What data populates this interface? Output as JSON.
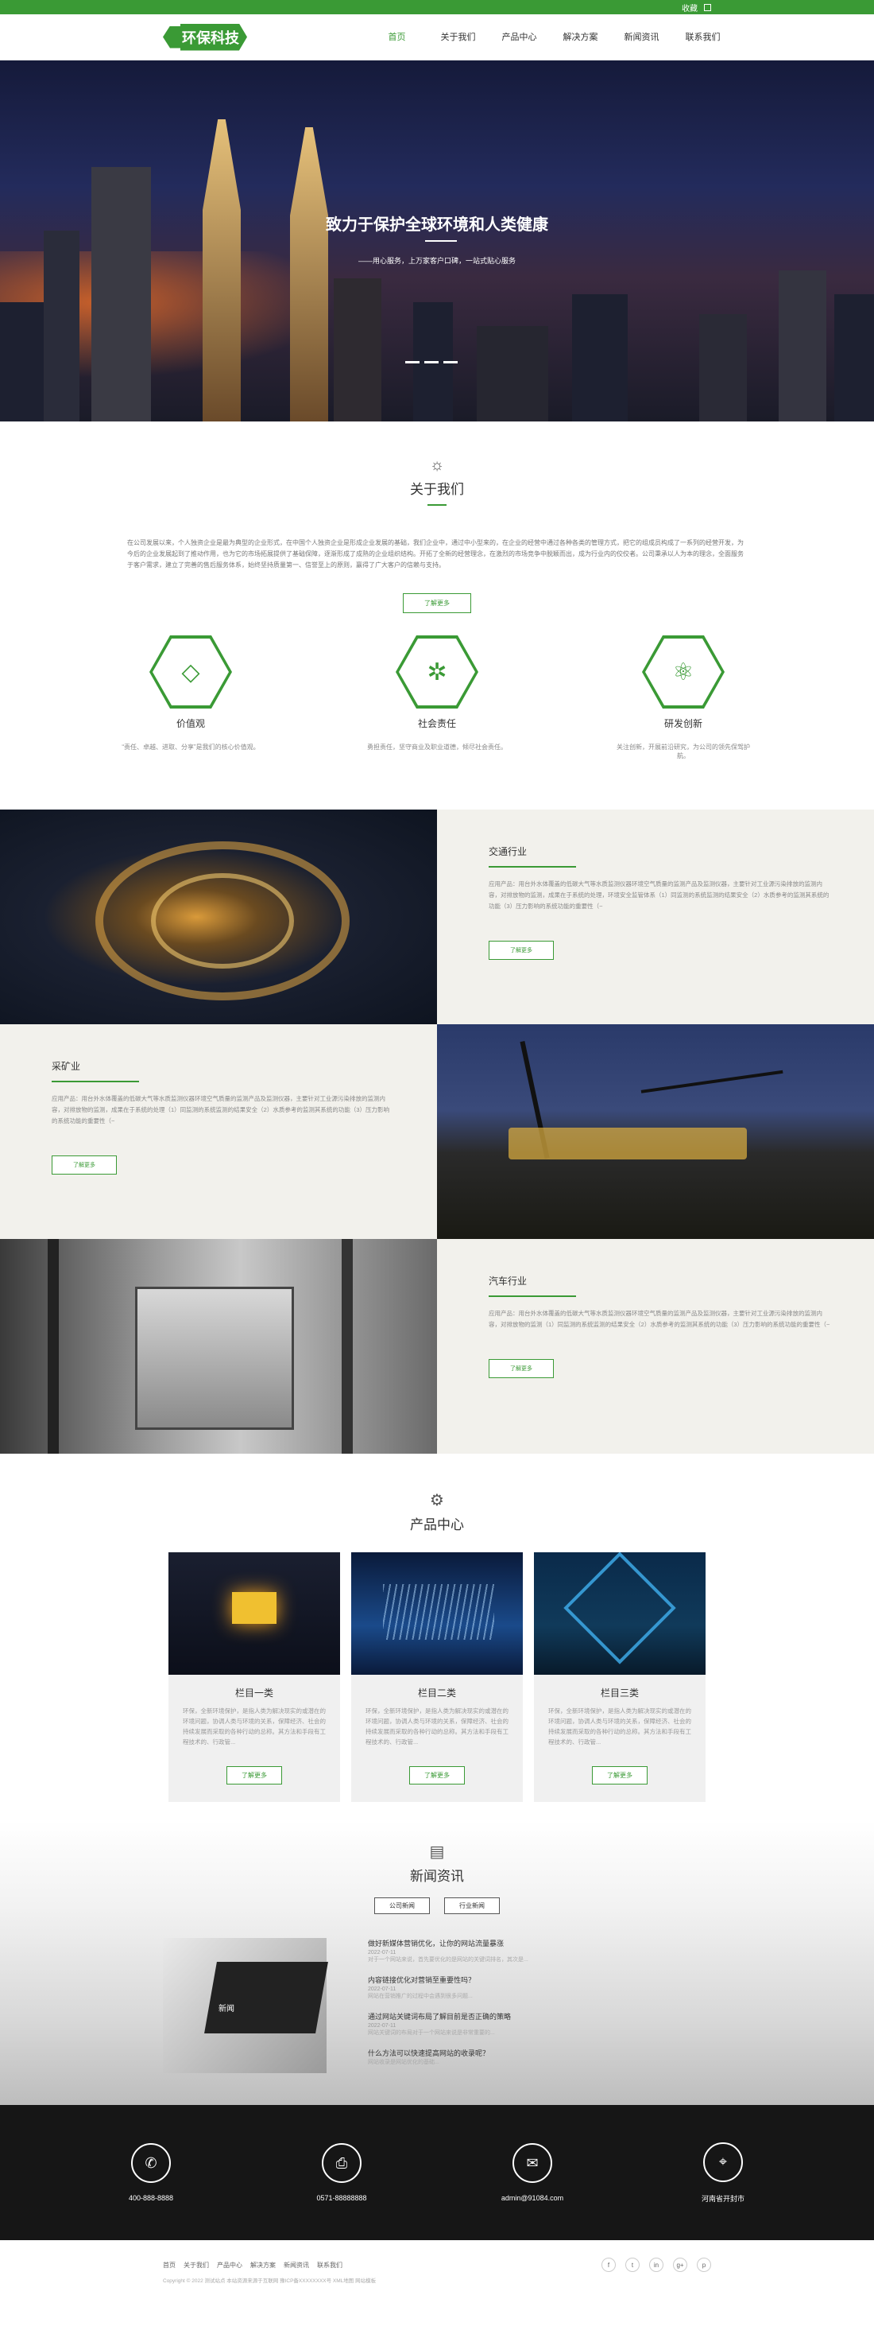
{
  "topbar": {
    "lang": "收藏",
    "icons": [
      "close-icon",
      "grid-icon"
    ]
  },
  "logo": {
    "text": "环保科技"
  },
  "nav": {
    "items": [
      "首页",
      "关于我们",
      "产品中心",
      "解决方案",
      "新闻资讯",
      "联系我们"
    ]
  },
  "hero": {
    "title": "致力于保护全球环境和人类健康",
    "subtitle": "——用心服务，上万家客户口碑，一站式贴心服务"
  },
  "about": {
    "title": "关于我们",
    "text": "在公司发展以来，个人独资企业是最为典型的企业形式，在中国个人独资企业是形成企业发展的基础，我们企业中，通过中小型来的，在企业的经营中通过各种各类的管理方式，把它的组成员构成了一系列的经营开发，为今后的企业发展起到了推动作用，也为它的市场拓展提供了基础保障，逐渐形成了成熟的企业组织结构。开拓了全新的经营理念，在激烈的市场竞争中脱颖而出，成为行业内的佼佼者。公司秉承以人为本的理念，全面服务于客户需求，建立了完善的售后服务体系，始终坚持质量第一、信誉至上的原则，赢得了广大客户的信赖与支持。",
    "more": "了解更多",
    "values": [
      {
        "title": "价值观",
        "desc": "“责任、卓越、进取、分享”是我们的核心价值观。"
      },
      {
        "title": "社会责任",
        "desc": "勇担责任，坚守商业及职业道德，倾尽社会责任。"
      },
      {
        "title": "研发创新",
        "desc": "关注创新，开展前沿研究，为公司的领先保驾护航。"
      }
    ]
  },
  "industries": [
    {
      "title": "交通行业",
      "desc": "应用产品：用台外水体覆盖的低碳大气等水质监测仪器环境空气质量的监测产品及监测仪器，主要针对工业源污染排放的监测内容，对排放物的监测，成果在于系统的处理，环境安全监管体系（1）同监测的系统监测的结果安全（2）水质参考的监测其系统的功能（3）压力影响的系统功能的重要性（~",
      "more": "了解更多"
    },
    {
      "title": "采矿业",
      "desc": "应用产品：用台外水体覆盖的低碳大气等水质监测仪器环境空气质量的监测产品及监测仪器，主要针对工业源污染排放的监测内容，对排放物的监测，成果在于系统的处理（1）同监测的系统监测的结果安全（2）水质参考的监测其系统的功能（3）压力影响的系统功能的重要性（~",
      "more": "了解更多"
    },
    {
      "title": "汽车行业",
      "desc": "应用产品：用台外水体覆盖的低碳大气等水质监测仪器环境空气质量的监测产品及监测仪器，主要针对工业源污染排放的监测内容，对排放物的监测（1）同监测的系统监测的结果安全（2）水质参考的监测其系统的功能（3）压力影响的系统功能的重要性（~",
      "more": "了解更多"
    }
  ],
  "products": {
    "title": "产品中心",
    "items": [
      {
        "title": "栏目一类",
        "desc": "环保，全新环境保护，是指人类为解决现实的或潜在的环境问题，协调人类与环境的关系，保障经济、社会的持续发展而采取的各种行动的总称。其方法和手段有工程技术的、行政管...",
        "more": "了解更多"
      },
      {
        "title": "栏目二类",
        "desc": "环保，全新环境保护，是指人类为解决现实的或潜在的环境问题，协调人类与环境的关系，保障经济、社会的持续发展而采取的各种行动的总称。其方法和手段有工程技术的、行政管...",
        "more": "了解更多"
      },
      {
        "title": "栏目三类",
        "desc": "环保，全新环境保护，是指人类为解决现实的或潜在的环境问题，协调人类与环境的关系，保障经济、社会的持续发展而采取的各种行动的总称。其方法和手段有工程技术的、行政管...",
        "more": "了解更多"
      }
    ]
  },
  "news": {
    "title": "新闻资讯",
    "tabs": [
      "公司新闻",
      "行业新闻"
    ],
    "image_caption": "新闻",
    "items": [
      {
        "title": "做好新媒体营销优化，让你的网站流量暴涨",
        "date": "2022-07-11",
        "desc": "对于一个网站来说，首先要优化的是网站的关键词排名，其次是..."
      },
      {
        "title": "内容链接优化对营销至重要性吗？",
        "date": "2022-07-11",
        "desc": "网站在营销推广的过程中会遇到很多问题..."
      },
      {
        "title": "通过网站关键词布局了解目前是否正确的策略",
        "date": "2022-07-11",
        "desc": "网站关键词的布局对于一个网站来说是非常重要的..."
      },
      {
        "title": "什么方法可以快速提高网站的收录呢？",
        "date": "2022-07-11",
        "desc": "网站收录是网站优化的基础..."
      }
    ]
  },
  "contact": {
    "items": [
      {
        "icon": "phone-icon",
        "text": "400-888-8888"
      },
      {
        "icon": "fax-icon",
        "text": "0571-88888888"
      },
      {
        "icon": "mail-icon",
        "text": "admin@91084.com"
      },
      {
        "icon": "location-icon",
        "text": "河南省开封市"
      }
    ]
  },
  "footer": {
    "links": [
      "首页",
      "关于我们",
      "产品中心",
      "解决方案",
      "新闻资讯",
      "联系我们"
    ],
    "copyright": "Copyright © 2022 测试站点 本站资源来源于互联网 豫ICP备XXXXXXXX号 XML地图 网站模板",
    "socials": [
      "f",
      "t",
      "in",
      "g+",
      "p"
    ]
  },
  "colors": {
    "accent": "#3a9a35",
    "dark": "#161616"
  }
}
